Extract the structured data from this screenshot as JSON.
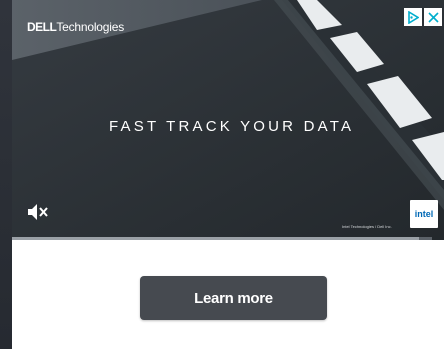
{
  "ad": {
    "brand_prefix": "DELL",
    "brand_suffix": "Technologies",
    "headline": "FAST TRACK YOUR DATA",
    "legal_text": "Intel Technologies / Dell Inc.",
    "partner_logo": "intel",
    "playback_progress": 0.97,
    "icons": {
      "mute": "muted-speaker-icon",
      "adchoices": "adchoices-icon",
      "close": "close-icon"
    }
  },
  "cta": {
    "label": "Learn more"
  },
  "colors": {
    "button_bg": "#464a50",
    "adchoices_accent": "#00aecd",
    "intel_blue": "#0068b5"
  }
}
